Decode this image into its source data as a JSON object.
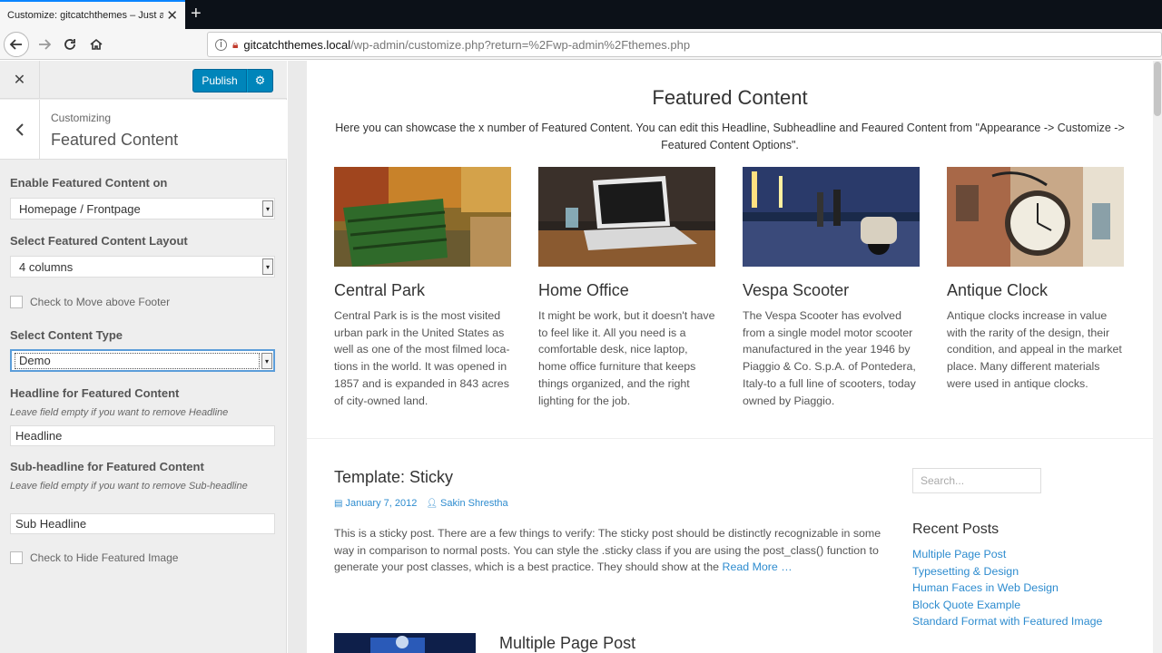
{
  "browser": {
    "tab_title": "Customize: gitcatchthemes – Just another WordPress site",
    "url_host": "gitcatchthemes.local",
    "url_path": "/wp-admin/customize.php?return=%2Fwp-admin%2Fthemes.php"
  },
  "sidebar": {
    "publish_label": "Publish",
    "breadcrumb": "Customizing",
    "section_title": "Featured Content",
    "enable_label": "Enable Featured Content on",
    "enable_value": "Homepage / Frontpage",
    "layout_label": "Select Featured Content Layout",
    "layout_value": "4 columns",
    "move_footer_label": "Check to Move above Footer",
    "type_label": "Select Content Type",
    "type_value": "Demo",
    "headline_label": "Headline for Featured Content",
    "headline_desc": "Leave field empty if you want to remove Headline",
    "headline_value": "Headline",
    "subheadline_label": "Sub-headline for Featured Content",
    "subheadline_desc": "Leave field empty if you want to remove Sub-headline",
    "subheadline_value": "Sub Headline",
    "hide_image_label": "Check to Hide Featured Image"
  },
  "preview": {
    "fc_title": "Featured Content",
    "fc_desc": "Here you can showcase the x number of Featured Content. You can edit this Headline, Subheadline and Feaured Content from \"Appearance -> Customize -> Featured Content Options\".",
    "items": [
      {
        "title": "Central Park",
        "text": "Central Park is is the most visited urban park in the United States as well as one of the most filmed loca- tions in the world. It was opened in 1857 and is expanded in 843 acres of city-owned land."
      },
      {
        "title": "Home Office",
        "text": "It might be work, but it doesn't have to feel like it. All you need is a comfortable desk, nice laptop, home office furniture that keeps things organized, and the right lighting for the job."
      },
      {
        "title": "Vespa Scooter",
        "text": "The Vespa Scooter has evolved from a single model motor scooter manufactured in the year 1946 by Piaggio & Co. S.p.A. of Pontedera, Italy-to a full line of scooters, today owned by Piaggio."
      },
      {
        "title": "Antique Clock",
        "text": "Antique clocks increase in value with the rarity of the design, their condition, and appeal in the market place. Many different materials were used in antique clocks."
      }
    ],
    "post_title": "Template: Sticky",
    "post_date": "January 7, 2012",
    "post_author": "Sakin Shrestha",
    "post_excerpt": "This is a sticky post. There are a few things to verify: The sticky post should be distinctly recognizable in some way in comparison to normal posts. You can style the .sticky class if you are using the post_class() function to generate your post classes, which is a best practice. They should show at the",
    "read_more": "Read More …",
    "post2_title": "Multiple Page Post",
    "search_placeholder": "Search...",
    "recent_title": "Recent Posts",
    "recent_posts": [
      "Multiple Page Post",
      "Typesetting & Design",
      "Human Faces in Web Design",
      "Block Quote Example",
      "Standard Format with Featured Image"
    ]
  },
  "colors": {
    "accent": "#0085ba",
    "link": "#2e8ccf"
  }
}
